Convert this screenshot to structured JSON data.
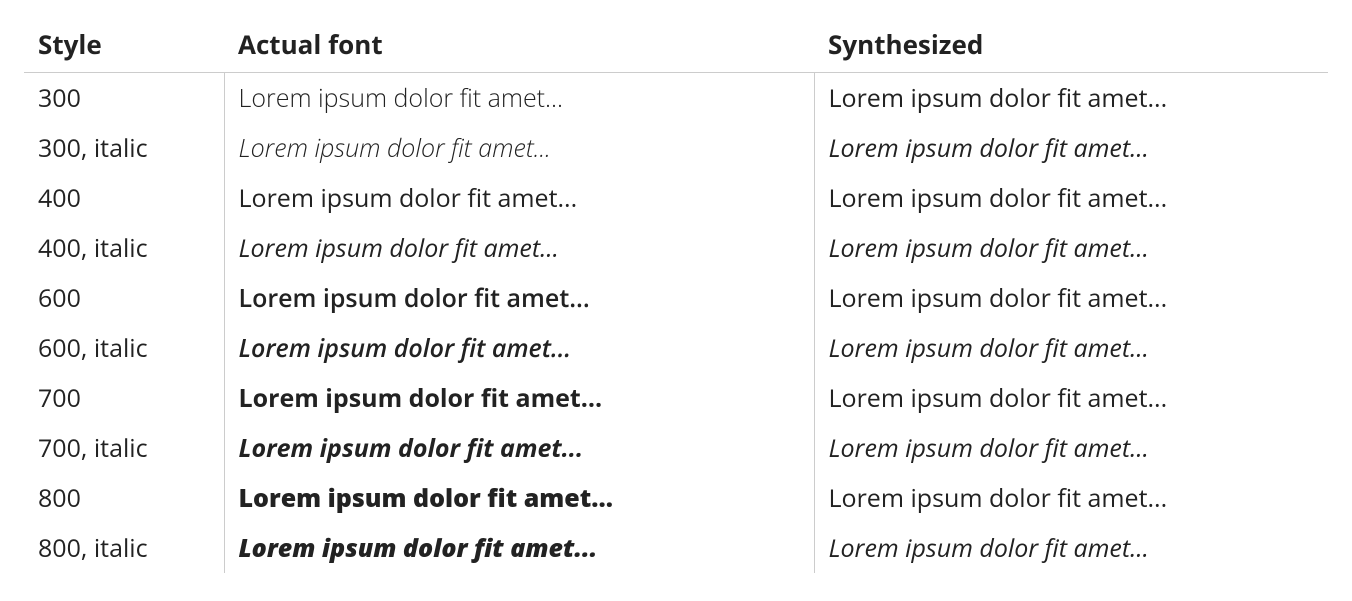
{
  "headers": {
    "style": "Style",
    "actual": "Actual font",
    "synthesized": "Synthesized"
  },
  "sample_text": "Lorem ipsum dolor fit amet...",
  "rows": [
    {
      "style_label": "300",
      "weight": 300,
      "italic": false
    },
    {
      "style_label": "300, italic",
      "weight": 300,
      "italic": true
    },
    {
      "style_label": "400",
      "weight": 400,
      "italic": false
    },
    {
      "style_label": "400, italic",
      "weight": 400,
      "italic": true
    },
    {
      "style_label": "600",
      "weight": 600,
      "italic": false
    },
    {
      "style_label": "600, italic",
      "weight": 600,
      "italic": true
    },
    {
      "style_label": "700",
      "weight": 700,
      "italic": false
    },
    {
      "style_label": "700, italic",
      "weight": 700,
      "italic": true
    },
    {
      "style_label": "800",
      "weight": 800,
      "italic": false
    },
    {
      "style_label": "800, italic",
      "weight": 800,
      "italic": true
    }
  ]
}
